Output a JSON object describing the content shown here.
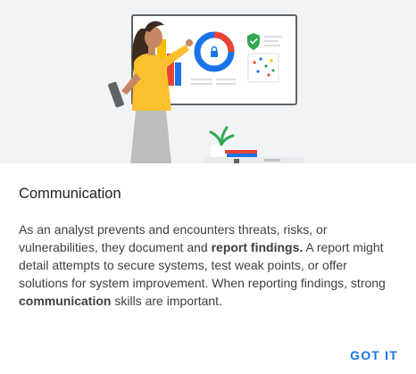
{
  "dialog": {
    "title": "Communication",
    "body": {
      "part1": "As an analyst prevents and encounters threats, risks, or vulnerabilities, they document and ",
      "bold1": "report findings.",
      "part2": " A report might detail attempts to secure systems, test weak points, or offer solutions for system improvement. When reporting findings, strong ",
      "bold2": "communication",
      "part3": " skills are important."
    },
    "action_label": "GOT IT"
  },
  "hero": {
    "illustration": "analyst-presenting-security-dashboard",
    "colors": {
      "background": "#f1f3f4",
      "board": "#ffffff",
      "accent_blue": "#1a73e8",
      "accent_red": "#ea4335",
      "accent_yellow": "#fbbc04",
      "accent_green": "#34a853",
      "shirt": "#fbc02d"
    }
  }
}
